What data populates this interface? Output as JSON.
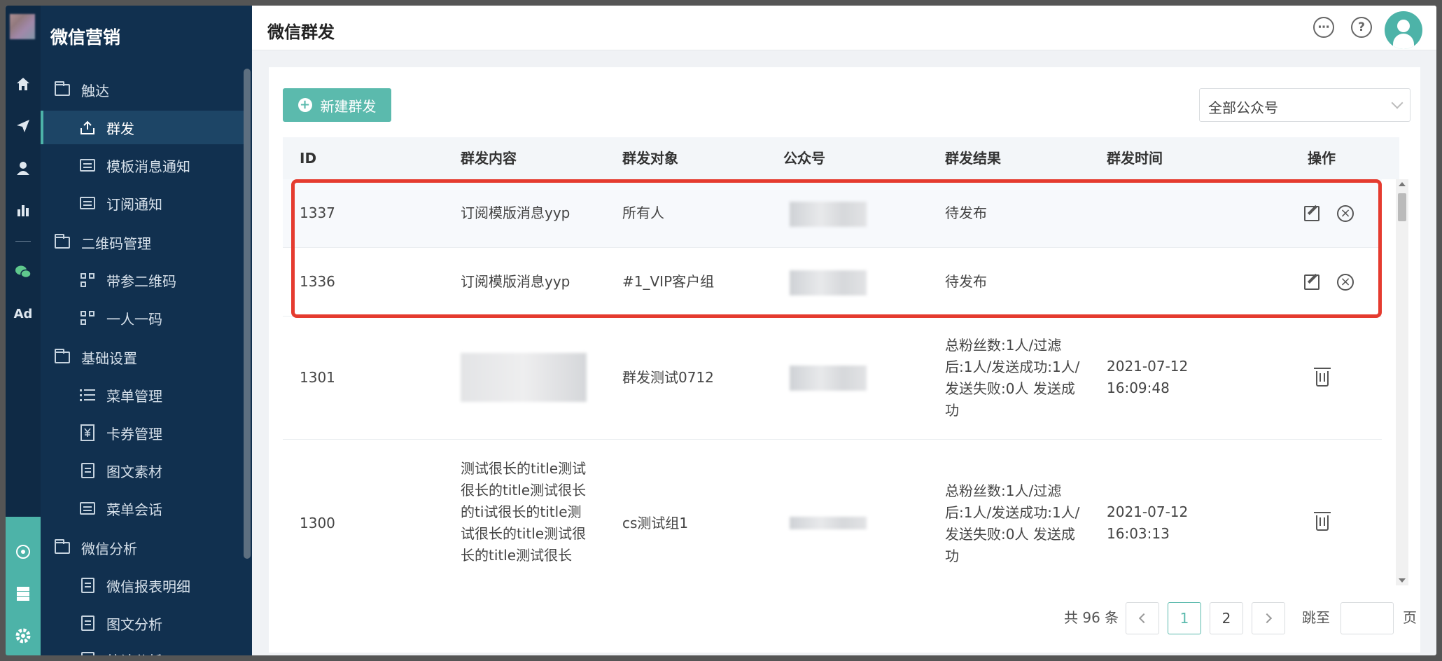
{
  "app": {
    "brand": "微信营销",
    "page_title": "微信群发"
  },
  "colors": {
    "accent": "#5bbaad",
    "sidebar_bg": "#11304f",
    "highlight": "#e53b2f"
  },
  "rail": {
    "icons": [
      "home-icon",
      "send-icon",
      "user-icon",
      "bar-chart-icon",
      "wechat-icon",
      "ad-icon",
      "target-icon",
      "server-icon",
      "settings-icon"
    ],
    "ad_label": "Ad"
  },
  "sidebar": {
    "groups": [
      {
        "label": "触达",
        "items": [
          "群发",
          "模板消息通知",
          "订阅通知"
        ]
      },
      {
        "label": "二维码管理",
        "items": [
          "带参二维码",
          "一人一码"
        ]
      },
      {
        "label": "基础设置",
        "items": [
          "菜单管理",
          "卡券管理",
          "图文素材",
          "菜单会话"
        ]
      },
      {
        "label": "微信分析",
        "items": [
          "微信报表明细",
          "图文分析",
          "统计分析"
        ]
      }
    ],
    "active_item": "群发"
  },
  "toolbar": {
    "new_button": "新建群发",
    "account_select": {
      "value": "全部公众号",
      "options": [
        "全部公众号"
      ]
    }
  },
  "table": {
    "columns": [
      "ID",
      "群发内容",
      "群发对象",
      "公众号",
      "群发结果",
      "群发时间",
      "操作"
    ],
    "rows": [
      {
        "id": "1337",
        "content": "订阅模版消息yyp",
        "target": "所有人",
        "result": "待发布",
        "time": "",
        "actions": [
          "edit",
          "cancel"
        ]
      },
      {
        "id": "1336",
        "content": "订阅模版消息yyp",
        "target": "#1_VIP客户组",
        "result": "待发布",
        "time": "",
        "actions": [
          "edit",
          "cancel"
        ]
      },
      {
        "id": "1301",
        "content": "",
        "target": "群发测试0712",
        "result": "总粉丝数:1人/过滤后:1人/发送成功:1人/发送失败:0人 发送成功",
        "time": "2021-07-12 16:09:48",
        "actions": [
          "delete"
        ]
      },
      {
        "id": "1300",
        "content": "测试很长的title测试很长的title测试很长的ti试很长的title测试很长的title测试很长的title测试很长",
        "target": "cs测试组1",
        "result": "总粉丝数:1人/过滤后:1人/发送成功:1人/发送失败:0人 发送成功",
        "time": "2021-07-12 16:03:13",
        "actions": [
          "delete"
        ]
      }
    ]
  },
  "pagination": {
    "total_text": "共 96 条",
    "pages": [
      "1",
      "2"
    ],
    "current": "1",
    "goto_label": "跳至",
    "page_unit": "页",
    "goto_value": ""
  }
}
